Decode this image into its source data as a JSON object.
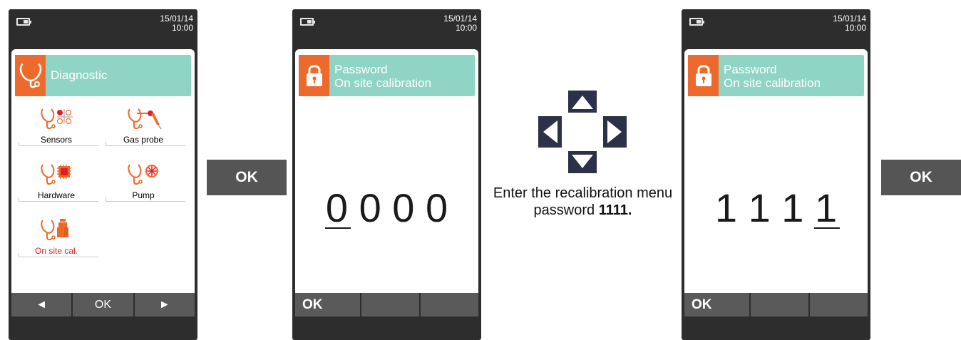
{
  "device1": {
    "date": "15/01/14",
    "time": "10:00",
    "header_title": "Diagnostic",
    "menu": [
      {
        "label": "Sensors",
        "icon": "sensors-icon",
        "color": "#000000"
      },
      {
        "label": "Gas probe",
        "icon": "gas-probe-icon",
        "color": "#000000"
      },
      {
        "label": "Hardware",
        "icon": "hardware-icon",
        "color": "#000000"
      },
      {
        "label": "Pump",
        "icon": "pump-icon",
        "color": "#000000"
      },
      {
        "label": "On site cal.",
        "icon": "on-site-cal-icon",
        "color": "#e02020"
      }
    ],
    "softkeys": [
      "◄",
      "OK",
      "►"
    ]
  },
  "ok_button_1": "OK",
  "device2": {
    "date": "15/01/14",
    "time": "10:00",
    "header_line1": "Password",
    "header_line2": "On site calibration",
    "digits": "0 0 0 0",
    "softkeys": [
      "OK",
      "",
      ""
    ]
  },
  "instruction": {
    "text": "Enter the recalibration menu password",
    "password": "1111."
  },
  "device3": {
    "date": "15/01/14",
    "time": "10:00",
    "header_line1": "Password",
    "header_line2": "On site calibration",
    "digits": "1 1 1 1",
    "softkeys": [
      "OK",
      "",
      ""
    ]
  },
  "ok_button_2": "OK",
  "colors": {
    "header_bg": "#8fd4c4",
    "icon_orange": "#ee6a2c",
    "device_body": "#2d2d2d",
    "arrow": "#2c3048",
    "ok_button": "#555555"
  }
}
